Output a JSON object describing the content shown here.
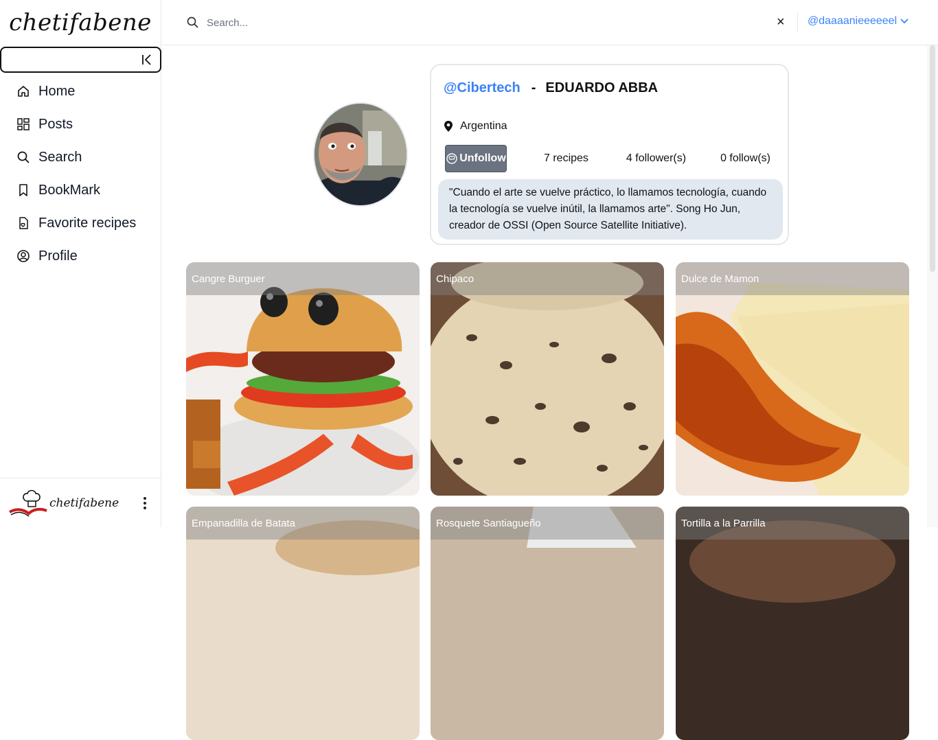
{
  "app": {
    "brand": "chetifabene",
    "footer_brand": "chetifabene"
  },
  "sidebar": {
    "items": [
      {
        "label": "Home",
        "icon": "home-icon"
      },
      {
        "label": "Posts",
        "icon": "grid-icon"
      },
      {
        "label": "Search",
        "icon": "search-icon"
      },
      {
        "label": "BookMark",
        "icon": "bookmark-icon"
      },
      {
        "label": "Favorite recipes",
        "icon": "favorite-doc-icon"
      },
      {
        "label": "Profile",
        "icon": "user-circle-icon"
      }
    ]
  },
  "topbar": {
    "search_placeholder": "Search...",
    "search_value": "",
    "clear_label": "×",
    "user_handle": "@daaaanieeeeeel"
  },
  "profile": {
    "username": "@Cibertech",
    "separator": "-",
    "full_name": "EDUARDO ABBA",
    "location": "Argentina",
    "unfollow_label": "Unfollow",
    "recipes": "7 recipes",
    "followers": "4 follower(s)",
    "follows": "0 follow(s)",
    "bio": "\"Cuando el arte se vuelve práctico, lo llamamos tecnología, cuando la tecnología se vuelve inútil, la llamamos arte\". Song Ho Jun, creador de OSSI (Open Source Satellite Initiative)."
  },
  "recipes": [
    {
      "title": "Cangre Burguer"
    },
    {
      "title": "Chipaco"
    },
    {
      "title": "Dulce de Mamon"
    },
    {
      "title": "Empanadilla de Batata"
    },
    {
      "title": "Rosquete Santiagueño"
    },
    {
      "title": "Tortilla a la Parrilla"
    }
  ],
  "colors": {
    "accent": "#3b82f6",
    "bio_bg": "#e2e8f0",
    "button_bg": "#6b7280"
  }
}
